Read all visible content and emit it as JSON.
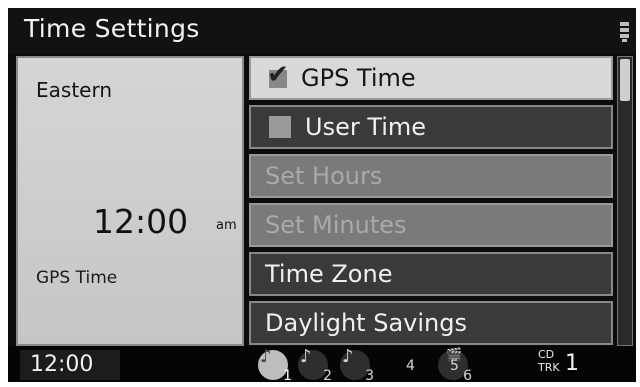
{
  "header": {
    "title": "Time Settings"
  },
  "left_panel": {
    "zone": "Eastern",
    "time": "12:00",
    "ampm": "am",
    "source": "GPS Time"
  },
  "menu": {
    "items": [
      {
        "label": "GPS Time",
        "state": "selected",
        "checked": true
      },
      {
        "label": "User Time",
        "state": "normal",
        "checked": false
      },
      {
        "label": "Set Hours",
        "state": "disabled"
      },
      {
        "label": "Set Minutes",
        "state": "disabled"
      },
      {
        "label": "Time Zone",
        "state": "normal"
      },
      {
        "label": "Daylight Savings",
        "state": "normal"
      }
    ]
  },
  "bottom_bar": {
    "clock": "12:00",
    "disc_slots": [
      "1",
      "2",
      "3",
      "4",
      "5",
      "6"
    ],
    "source_line1": "CD",
    "source_line2": "TRK",
    "track": "1"
  },
  "icons": {
    "status": "phone-signal-icon",
    "check": "checkmark-icon",
    "disc": "music-disc-icon",
    "video": "clapperboard-icon"
  },
  "colors": {
    "background": "#0c0c0c",
    "selected_item": "#d9d9d9",
    "normal_item": "#3a3a3a",
    "disabled_item": "#7a7a7a",
    "panel": "#cecece"
  }
}
